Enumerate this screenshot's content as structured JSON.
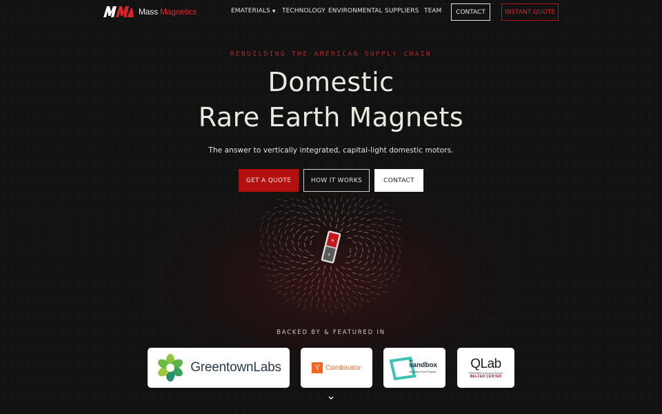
{
  "header": {
    "brand_part1": "Mass",
    "brand_part2": "Magnetics",
    "nav": [
      {
        "label": "EMATERIALS",
        "has_dropdown": true
      },
      {
        "label": "TECHNOLOGY"
      },
      {
        "label": "ENVIRONMENTAL"
      },
      {
        "label": "SUPPLIERS"
      },
      {
        "label": "TEAM"
      }
    ],
    "contact_button": "CONTACT",
    "instant_quote_button": "INSTANT QUOTE"
  },
  "hero": {
    "eyebrow": "REBUILDING THE AMERICAN SUPPLY CHAIN",
    "title_line1": "Domestic",
    "title_line2": "Rare Earth Magnets",
    "subtitle": "The answer to vertically integrated, capital-light domestic motors.",
    "cta_quote": "GET A QUOTE",
    "cta_how": "HOW IT WORKS",
    "cta_contact": "CONTACT"
  },
  "magnet": {
    "north": "N",
    "south": "S"
  },
  "backed": {
    "heading": "BACKED BY & FEATURED IN",
    "logos": [
      {
        "name": "Greentown Labs",
        "text_a": "Greentown",
        "text_b": "Labs"
      },
      {
        "name": "Y Combinator",
        "mark": "Y",
        "text": "Combinator"
      },
      {
        "name": "MIT sandbox",
        "small": "MIT",
        "main": "sandbox",
        "tag": "Innovation Fund Program"
      },
      {
        "name": "QLab",
        "title": "QLab",
        "sub1": "HARVARD Kennedy School",
        "sub2": "BELFER CENTER"
      }
    ]
  },
  "colors": {
    "background": "#121212",
    "accent_red": "#b3100f",
    "brand_red": "#e0242a",
    "text": "#ece9e1"
  },
  "icons": {
    "scroll_down": "chevron-down-icon",
    "nav_dropdown": "caret-down-icon"
  }
}
